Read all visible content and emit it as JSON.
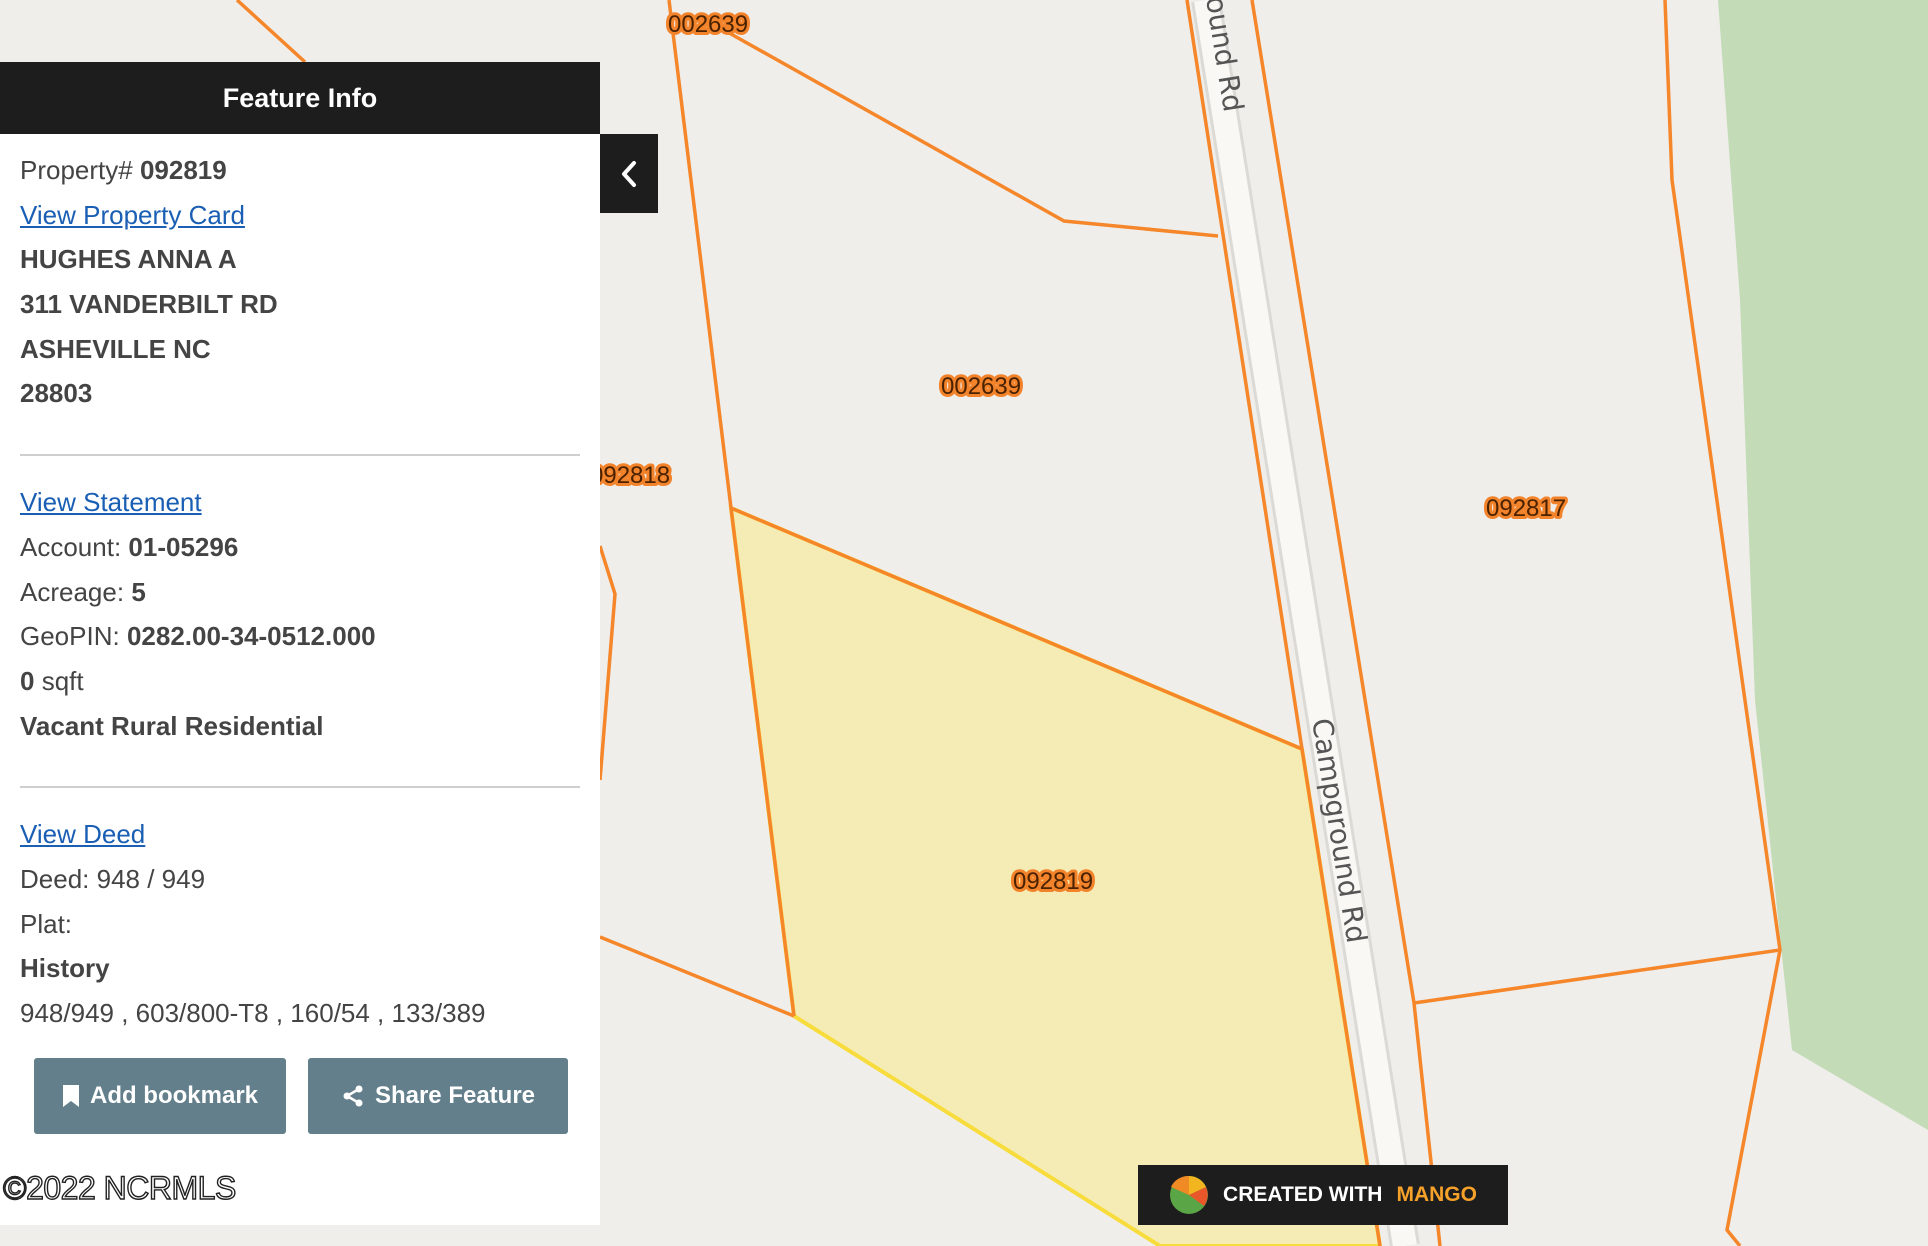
{
  "map": {
    "parcel_labels": [
      "002639",
      "002639",
      "092818",
      "092817",
      "092819"
    ],
    "road_labels": [
      "Campground Rd",
      "ound Rd"
    ],
    "colors": {
      "parcel_line": "#f5862a",
      "selected_fill": "#f5ecb5",
      "selected_outline": "#f7dc3b",
      "green_area": "#c3dbb6",
      "road": "#f9f8f5"
    }
  },
  "panel": {
    "title": "Feature Info",
    "collapse_icon": "chevron-left-icon",
    "property_label": "Property#",
    "property_number": "092819",
    "view_property_card": "View Property Card",
    "owner_name": "HUGHES ANNA A",
    "address_line1": "311 VANDERBILT RD",
    "address_line2": "ASHEVILLE NC",
    "zip": "28803",
    "view_statement": "View Statement",
    "account_label": "Account:",
    "account_value": "01-05296",
    "acreage_label": "Acreage:",
    "acreage_value": "5",
    "geopin_label": "GeoPIN:",
    "geopin_value": "0282.00-34-0512.000",
    "sqft_value": "0",
    "sqft_unit": "sqft",
    "land_use": "Vacant Rural Residential",
    "view_deed": "View Deed",
    "deed": "Deed: 948 / 949",
    "plat": "Plat:",
    "history_label": "History",
    "history_value": "948/949 , 603/800-T8 , 160/54 , 133/389",
    "add_bookmark": "Add bookmark",
    "share_feature": "Share Feature"
  },
  "copyright": "©2022 NCRMLS",
  "branding": {
    "created_with": "CREATED WITH",
    "brand": "MANGO"
  }
}
